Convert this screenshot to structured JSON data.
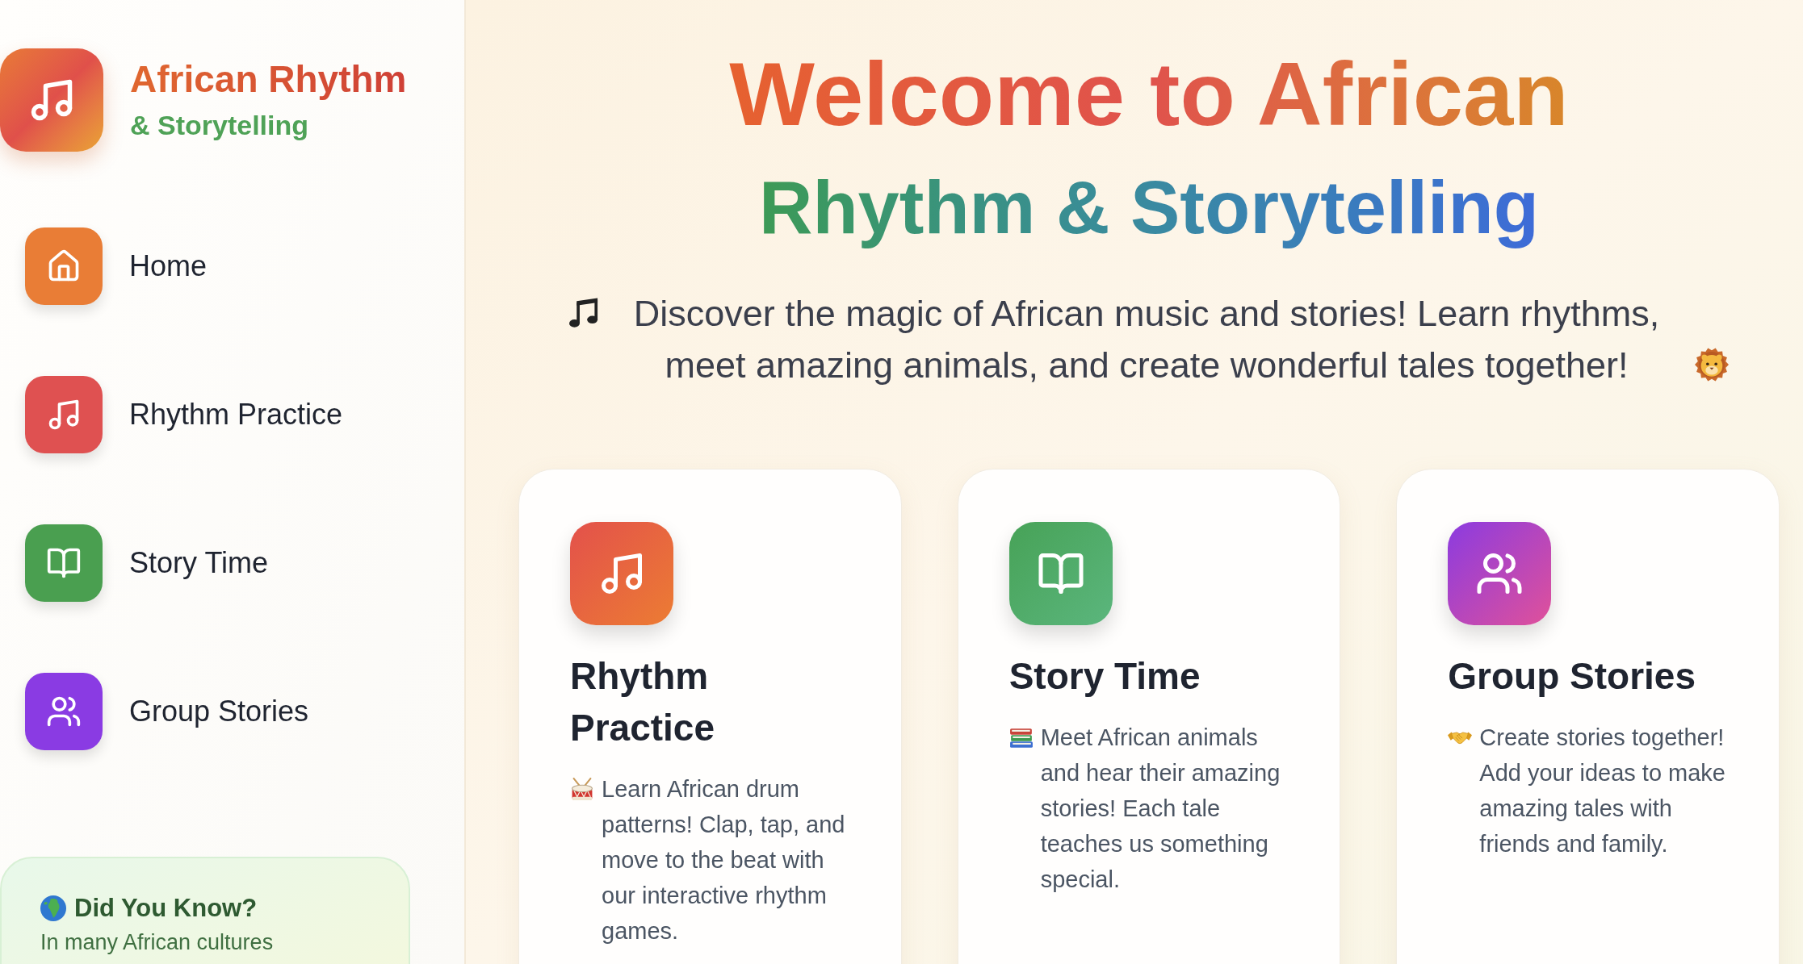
{
  "sidebar": {
    "logo": {
      "title": "African Rhythm",
      "subtitle": "& Storytelling"
    },
    "nav_items": [
      {
        "label": "Home",
        "kind": "home",
        "color": "#e97d36"
      },
      {
        "label": "Rhythm Practice",
        "kind": "rhythm",
        "color": "#df5151"
      },
      {
        "label": "Story Time",
        "kind": "story",
        "color": "#4a9f50"
      },
      {
        "label": "Group Stories",
        "kind": "group",
        "color": "#8a3be3"
      }
    ],
    "fact_card": {
      "title": "Did You Know?",
      "text": "In many African cultures"
    }
  },
  "hero": {
    "title_line_1": "Welcome to African",
    "title_line_2": "Rhythm & Storytelling",
    "intro": "Discover the magic of African music and stories! Learn rhythms, meet amazing animals, and create wonderful tales together!"
  },
  "cards": [
    {
      "kind": "rhythm",
      "title": "Rhythm Practice",
      "description": "Learn African drum patterns! Clap, tap, and move to the beat with our interactive rhythm games.",
      "color": "#e3514b"
    },
    {
      "kind": "story",
      "title": "Story Time",
      "description": "Meet African animals and hear their amazing stories! Each tale teaches us something special.",
      "color": "#47a257"
    },
    {
      "kind": "group",
      "title": "Group Stories",
      "description": "Create stories together! Add your ideas to make amazing tales with friends and family.",
      "color": "#8b3be0"
    }
  ]
}
